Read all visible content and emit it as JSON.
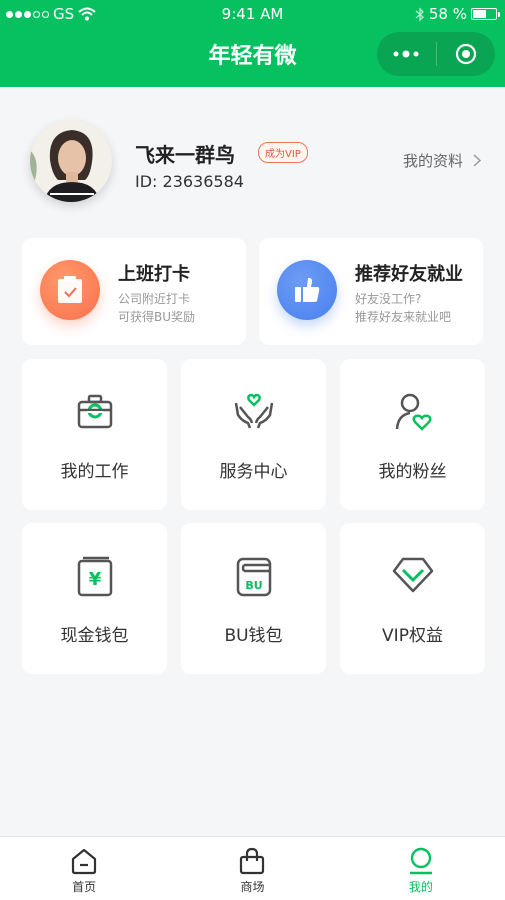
{
  "status_bar": {
    "carrier": "GS",
    "signal_strength": "3 of 5",
    "time": "9:41 AM",
    "battery_text": "58 %",
    "battery_level": 0.58
  },
  "nav": {
    "title": "年轻有微",
    "more_icon": "more-dots-icon",
    "close_icon": "target-circle-icon"
  },
  "profile": {
    "name": "飞来一群鸟",
    "vip_badge": "成为VIP",
    "id_text": "ID: 23636584",
    "link_label": "我的资料",
    "link_icon": "chevron-right-icon"
  },
  "wide_cards": [
    {
      "title": "上班打卡",
      "sub1": "公司附近打卡",
      "sub2": "可获得BU奖励",
      "icon": "clipboard-check-icon",
      "color": "#fb7a52"
    },
    {
      "title": "推荐好友就业",
      "sub1": "好友没工作?",
      "sub2": "推荐好友来就业吧",
      "icon": "thumbs-up-icon",
      "color": "#4f86f0"
    }
  ],
  "grid": [
    {
      "label": "我的工作",
      "icon": "briefcase-icon"
    },
    {
      "label": "服务中心",
      "icon": "hands-heart-icon"
    },
    {
      "label": "我的粉丝",
      "icon": "user-heart-icon"
    },
    {
      "label": "现金钱包",
      "icon": "yuan-wallet-icon"
    },
    {
      "label": "BU钱包",
      "icon": "bu-wallet-icon"
    },
    {
      "label": "VIP权益",
      "icon": "diamond-icon"
    }
  ],
  "accent_color": "#07c160",
  "tabbar": [
    {
      "label": "首页",
      "icon": "home-icon",
      "active": false
    },
    {
      "label": "商场",
      "icon": "shopping-bag-icon",
      "active": false
    },
    {
      "label": "我的",
      "icon": "profile-icon",
      "active": true
    }
  ]
}
